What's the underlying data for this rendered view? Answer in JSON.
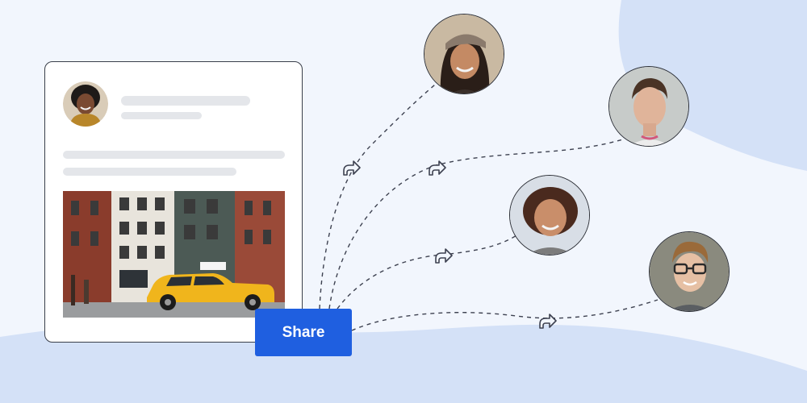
{
  "share_button": {
    "label": "Share"
  },
  "colors": {
    "accent": "#1f5fe0",
    "background": "#f2f6fd",
    "wave": "#d4e1f7",
    "skeleton": "#e4e6ea"
  },
  "icons": {
    "share_arrow": "share-arrow-icon"
  },
  "recipients": [
    {
      "name": "recipient-woman-cap"
    },
    {
      "name": "recipient-young-man"
    },
    {
      "name": "recipient-woman-curly-hair"
    },
    {
      "name": "recipient-man-glasses"
    }
  ]
}
